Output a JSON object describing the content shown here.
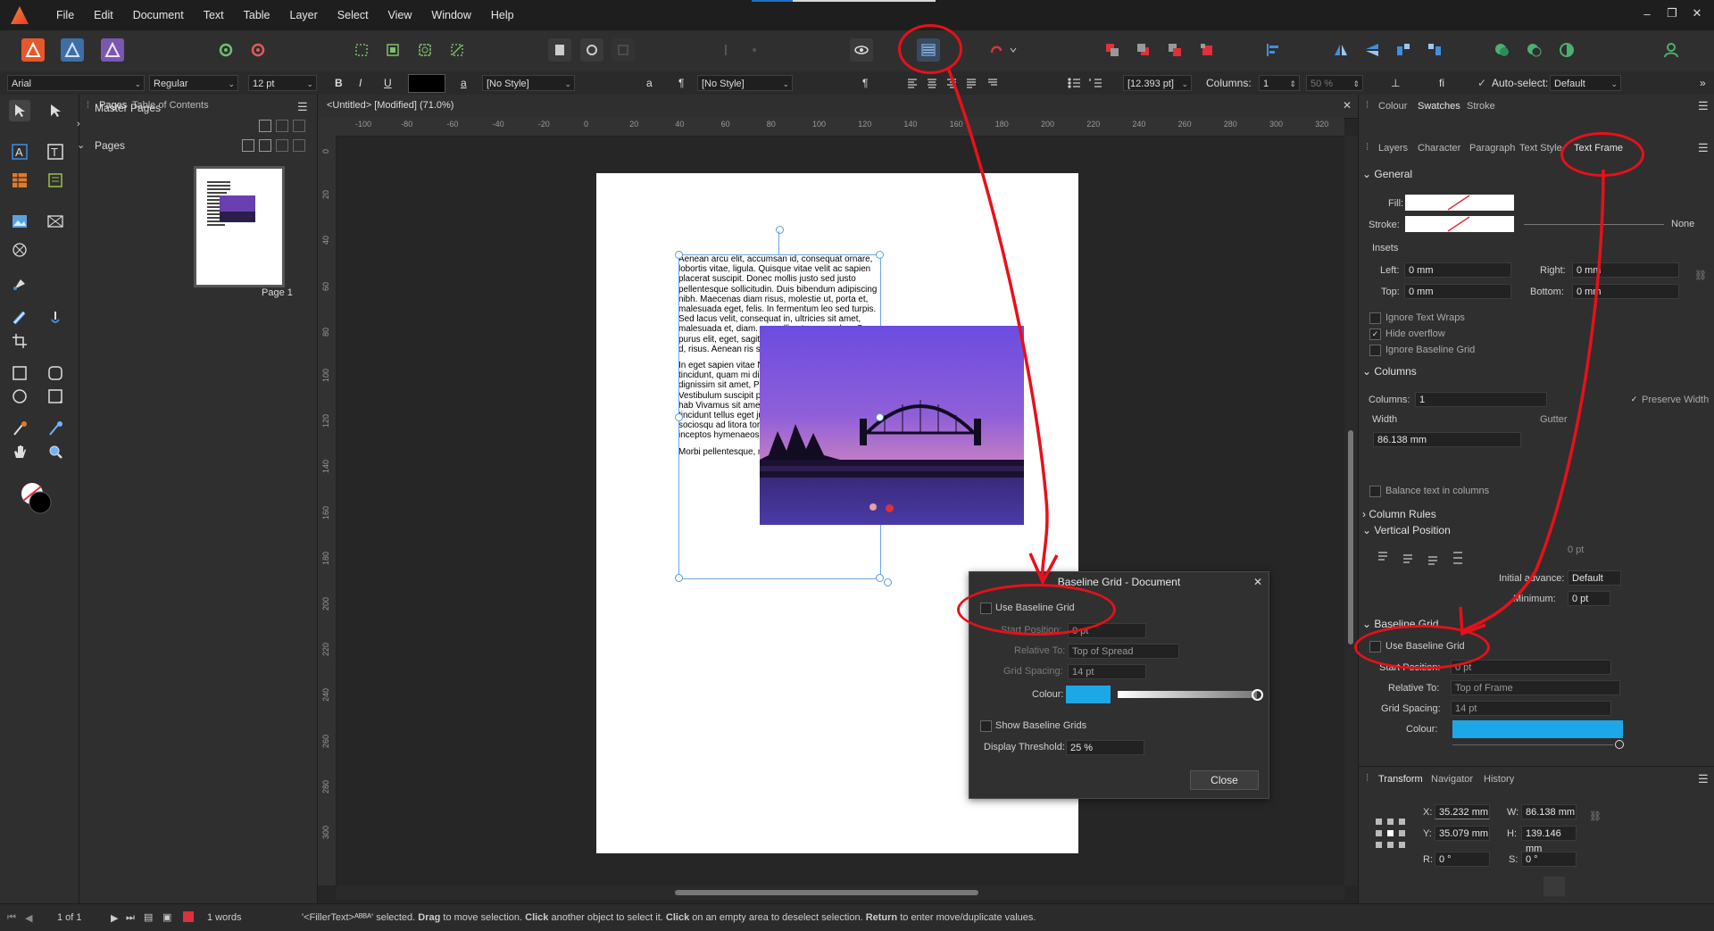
{
  "menubar": {
    "items": [
      "File",
      "Edit",
      "Document",
      "Text",
      "Table",
      "Layer",
      "Select",
      "View",
      "Window",
      "Help"
    ],
    "window_controls": [
      "–",
      "❐",
      "✕"
    ]
  },
  "context_toolbar": {
    "font": "Arial",
    "style": "Regular",
    "size": "12 pt",
    "bold": "B",
    "italic": "I",
    "underline": "U",
    "char_style_glyph": "a",
    "char_style": "[No Style]",
    "para_glyph": "¶",
    "para_style": "[No Style]",
    "leading": "[12.393 pt]",
    "columns_label": "Columns:",
    "columns_value": "1",
    "percent": "50 %",
    "autoselect_label": "Auto-select:",
    "autoselect_value": "Default"
  },
  "pages_panel": {
    "tabs": [
      "Pages",
      "Table of Contents"
    ],
    "master_pages": "Master Pages",
    "pages": "Pages",
    "page_label": "Page 1"
  },
  "document": {
    "tab_title": "<Untitled> [Modified] (71.0%)",
    "h_ruler": [
      "-100",
      "-80",
      "-60",
      "-40",
      "-20",
      "0",
      "20",
      "40",
      "60",
      "80",
      "100",
      "120",
      "140",
      "160",
      "180",
      "200",
      "220",
      "240",
      "260",
      "280",
      "300",
      "320"
    ],
    "v_ruler": [
      "0",
      "20",
      "40",
      "60",
      "80",
      "100",
      "120",
      "140",
      "160",
      "180",
      "200",
      "220",
      "240",
      "260",
      "280",
      "300"
    ],
    "text_paragraphs": [
      "Aenean arcu elit, accumsan id, consequat ornare, lobortis vitae, ligula. Quisque vitae velit ac sapien placerat suscipit. Donec mollis justo sed justo pellentesque sollicitudin. Duis bibendum adipiscing nibh. Maecenas diam risus, molestie ut, porta et, malesuada eget, felis. In fermentum leo sed turpis. Sed lacus velit, consequat in, ultricies sit amet, malesuada et, diam. convallis ut, conseq leo. Cras purus elit, eget, sagittis at, nul faucibus dictum, co d, risus. Aenean ris scelerisque placera",
      "In eget sapien vitae Nullam at leo nec m Phasellus tincidunt, quam mi dictum libe elit ut lectus. Sed d dignissim sit amet, Pellentesque nec le lobortis. Vestibulum suscipit pulvinar. Se volutpat. In hac hab Vivamus sit amet s consequat. Integer tincidunt tellus eget justo. Class aptent taciti sociosqu ad litora torquent per conubia nostra, per inceptos hymenaeos.",
      "Morbi pellentesque, mauris interdum porta"
    ]
  },
  "baseline_dialog": {
    "title": "Baseline Grid - Document",
    "use_baseline_grid": "Use Baseline Grid",
    "start_position_label": "Start Position:",
    "start_position_value": "0 pt",
    "relative_to_label": "Relative To:",
    "relative_to_value": "Top of Spread",
    "grid_spacing_label": "Grid Spacing:",
    "grid_spacing_value": "14 pt",
    "colour_label": "Colour:",
    "show_grids": "Show Baseline Grids",
    "threshold_label": "Display Threshold:",
    "threshold_value": "25 %",
    "close": "Close",
    "accent": "#1ea7e6"
  },
  "right_panel": {
    "top_tabs": [
      "Colour",
      "Swatches",
      "Stroke"
    ],
    "studio_tabs": [
      "Layers",
      "Character",
      "Paragraph",
      "Text Style",
      "Text Frame"
    ],
    "general": "General",
    "fill_label": "Fill:",
    "stroke_label": "Stroke:",
    "none_label": "None",
    "insets": "Insets",
    "left_label": "Left:",
    "left_value": "0 mm",
    "right_label": "Right:",
    "right_value": "0 mm",
    "top_label": "Top:",
    "top_value": "0 mm",
    "bottom_label": "Bottom:",
    "bottom_value": "0 mm",
    "ignore_wraps": "Ignore Text Wraps",
    "hide_overflow": "Hide overflow",
    "ignore_baseline": "Ignore Baseline Grid",
    "columns": "Columns",
    "columns_label": "Columns:",
    "columns_value": "1",
    "preserve_width": "Preserve Width",
    "width_label": "Width",
    "gutter_label": "Gutter",
    "width_value": "86.138 mm",
    "balance": "Balance text in columns",
    "column_rules": "Column Rules",
    "vertical_position": "Vertical Position",
    "vp_value": "0 pt",
    "initial_advance_label": "Initial advance:",
    "initial_advance_value": "Default",
    "minimum_label": "Minimum:",
    "minimum_value": "0 pt",
    "baseline_grid": "Baseline Grid",
    "use_baseline": "Use Baseline Grid",
    "start_position_label": "Start Position:",
    "start_position_value": "0 pt",
    "relative_to_label": "Relative To:",
    "relative_to_value": "Top of Frame",
    "grid_spacing_label": "Grid Spacing:",
    "grid_spacing_value": "14 pt",
    "colour_label": "Colour:",
    "bottom_tabs": [
      "Transform",
      "Navigator",
      "History"
    ],
    "x_label": "X:",
    "x_value": "35.232 mm",
    "y_label": "Y:",
    "y_value": "35.079 mm",
    "w_label": "W:",
    "w_value": "86.138 mm",
    "h_label": "H:",
    "h_value": "139.146 mm",
    "r_label": "R:",
    "r_value": "0 °",
    "s_label": "S:",
    "s_value": "0 °"
  },
  "status": {
    "page_indicator": "1 of 1",
    "words": "1 words",
    "message_parts": [
      "'<FillerText>ᴬᴮᴮᴬ' selected. ",
      "Drag",
      " to move selection. ",
      "Click",
      " another object to select it. ",
      "Click",
      " on an empty area to deselect selection. ",
      "Return",
      " to enter move/duplicate values."
    ]
  }
}
